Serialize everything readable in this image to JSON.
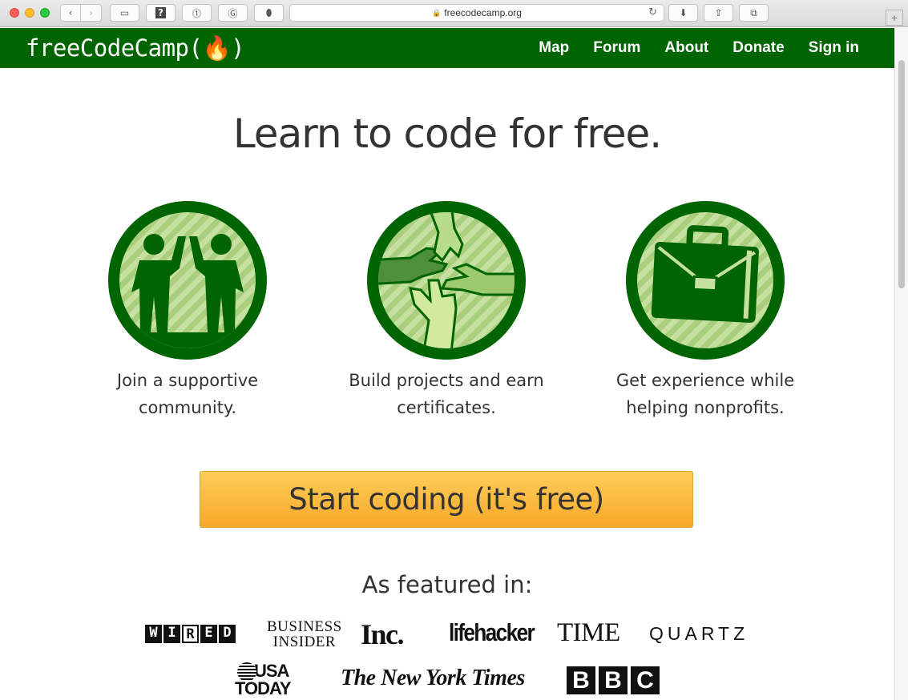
{
  "browser": {
    "url": "freecodecamp.org",
    "reload_icon": "reload-icon",
    "new_tab_label": "+"
  },
  "site": {
    "brand": "freeCodeCamp(🔥)",
    "nav": [
      {
        "label": "Map"
      },
      {
        "label": "Forum"
      },
      {
        "label": "About"
      },
      {
        "label": "Donate"
      },
      {
        "label": "Sign in"
      }
    ]
  },
  "main": {
    "headline": "Learn to code for free.",
    "features": [
      {
        "icon": "high-five-icon",
        "line1": "Join a supportive",
        "line2": "community."
      },
      {
        "icon": "hands-together-icon",
        "line1": "Build projects and earn",
        "line2": "certificates."
      },
      {
        "icon": "briefcase-icon",
        "line1": "Get experience while",
        "line2": "helping nonprofits."
      }
    ],
    "cta_label": "Start coding (it's free)",
    "featured_title": "As featured in:",
    "logos": {
      "wired": [
        "W",
        "I",
        "R",
        "E",
        "D"
      ],
      "business_insider_1": "BUSINESS",
      "business_insider_2": "INSIDER",
      "inc": "Inc.",
      "lifehacker": "lifehacker",
      "time": "TIME",
      "quartz": "QUARTZ",
      "usa_today_1": "USA",
      "usa_today_2": "TODAY",
      "nyt": "The New York Times",
      "bbc": [
        "B",
        "B",
        "C"
      ]
    }
  },
  "colors": {
    "brand_green": "#006400",
    "icon_light": "#c5e0a0",
    "cta_top": "#fece5a",
    "cta_bottom": "#f7a829"
  }
}
